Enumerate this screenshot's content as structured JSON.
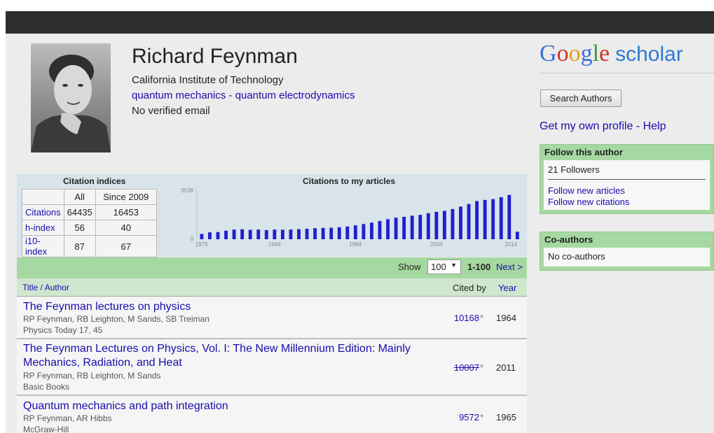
{
  "profile": {
    "name": "Richard Feynman",
    "affiliation": "California Institute of Technology",
    "interests": "quantum mechanics - quantum electrodynamics",
    "email": "No verified email"
  },
  "logo": {
    "google": "Google",
    "scholar": "scholar"
  },
  "sidebar": {
    "search_authors": "Search Authors",
    "own_profile": "Get my own profile - Help",
    "follow_title": "Follow this author",
    "followers": "21 Followers",
    "follow_articles": "Follow new articles",
    "follow_citations": "Follow new citations",
    "coauthors_title": "Co-authors",
    "coauthors_value": "No co-authors"
  },
  "indices": {
    "title": "Citation indices",
    "col_all": "All",
    "col_since": "Since 2009",
    "rows": [
      {
        "label": "Citations",
        "all": "64435",
        "since": "16453"
      },
      {
        "label": "h-index",
        "all": "56",
        "since": "40"
      },
      {
        "label": "i10-index",
        "all": "87",
        "since": "67"
      }
    ]
  },
  "chart_data": {
    "type": "bar",
    "title": "Citations to my articles",
    "xlabel": "",
    "ylabel": "",
    "ylim": [
      0,
      3538
    ],
    "y_tick_labels": [
      "3538",
      "0"
    ],
    "x_tick_labels": [
      "1975",
      "1984",
      "1994",
      "2004",
      "2014"
    ],
    "color": "#1f1fd0",
    "categories": [
      1975,
      1976,
      1977,
      1978,
      1979,
      1980,
      1981,
      1982,
      1983,
      1984,
      1985,
      1986,
      1987,
      1988,
      1989,
      1990,
      1991,
      1992,
      1993,
      1994,
      1995,
      1996,
      1997,
      1998,
      1999,
      2000,
      2001,
      2002,
      2003,
      2004,
      2005,
      2006,
      2007,
      2008,
      2009,
      2010,
      2011,
      2012,
      2013,
      2014
    ],
    "values": [
      380,
      500,
      520,
      620,
      700,
      720,
      680,
      700,
      660,
      700,
      690,
      700,
      730,
      760,
      800,
      820,
      830,
      870,
      920,
      1000,
      1100,
      1200,
      1320,
      1450,
      1560,
      1620,
      1700,
      1760,
      1880,
      1980,
      2050,
      2180,
      2360,
      2540,
      2760,
      2840,
      2900,
      3040,
      3200,
      540
    ]
  },
  "articles": {
    "show_label": "Show",
    "show_value": "100",
    "range": "1-100",
    "next": "Next >",
    "col_title": "Title / Author",
    "col_cited": "Cited by",
    "col_year": "Year",
    "items": [
      {
        "title": "The Feynman lectures on physics",
        "authors": "RP Feynman, RB Leighton, M Sands, SB Treiman",
        "source": "Physics Today 17, 45",
        "cited": "10168",
        "star": "*",
        "year": "1964"
      },
      {
        "title": "The Feynman Lectures on Physics, Vol. I: The New Millennium Edition: Mainly Mechanics, Radiation, and Heat",
        "authors": "RP Feynman, RB Leighton, M Sands",
        "source": "Basic Books",
        "cited": "10007",
        "star": "*",
        "year": "2011"
      },
      {
        "title": "Quantum mechanics and path integration",
        "authors": "RP Feynman, AR Hibbs",
        "source": "McGraw-Hill",
        "cited": "9572",
        "star": "*",
        "year": "1965"
      }
    ]
  }
}
